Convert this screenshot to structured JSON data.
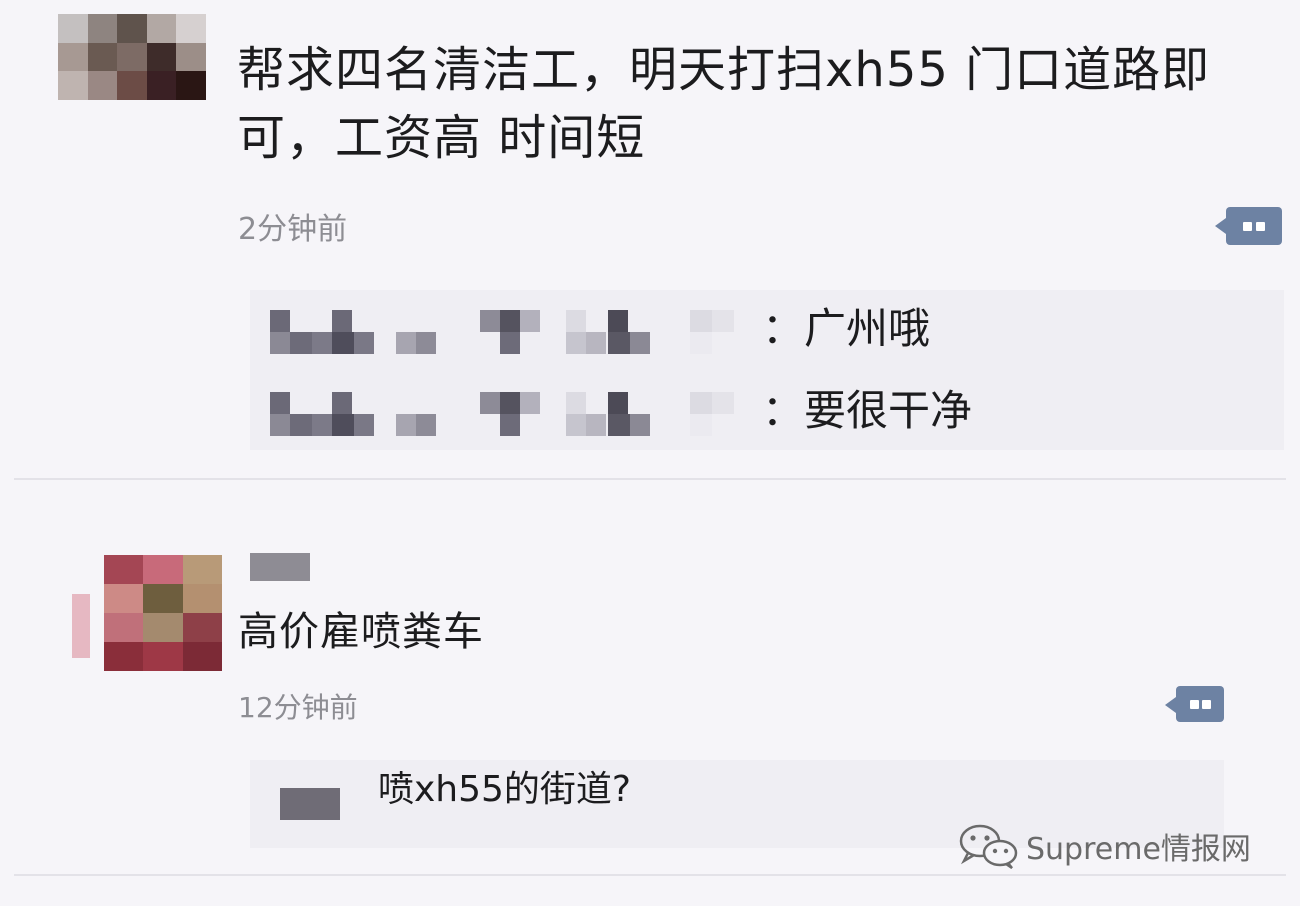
{
  "posts": [
    {
      "text": "帮求四名清洁工，明天打扫xh55 门口道路即可，工资高 时间短",
      "timestamp": "2分钟前",
      "avatar_colors": [
        "#c4c0c0",
        "#8e8480",
        "#5f534c",
        "#b2a8a4",
        "#d6d0d0",
        "#a79993",
        "#6a5a52",
        "#7d6b65",
        "#3e2c2a",
        "#9c8e88",
        "#bfb4b0",
        "#9a8884",
        "#6c4c46",
        "#3a2024",
        "#2a1614"
      ],
      "replies": [
        {
          "text": "：广州哦"
        },
        {
          "text": "：要很干净"
        }
      ]
    },
    {
      "text": "高价雇喷粪车",
      "timestamp": "12分钟前",
      "avatar_colors": [
        "#a44654",
        "#c86a7a",
        "#b89a78",
        "#cd8a86",
        "#6e5e3e",
        "#b49070",
        "#c0707a",
        "#a48a6e",
        "#8e4048",
        "#8a2e3a",
        "#9e3846",
        "#7c2a36"
      ],
      "replies": [
        {
          "text": "喷xh55的街道?"
        }
      ]
    }
  ],
  "watermark": {
    "text": "Supreme情报网",
    "icon": "wechat-icon"
  }
}
